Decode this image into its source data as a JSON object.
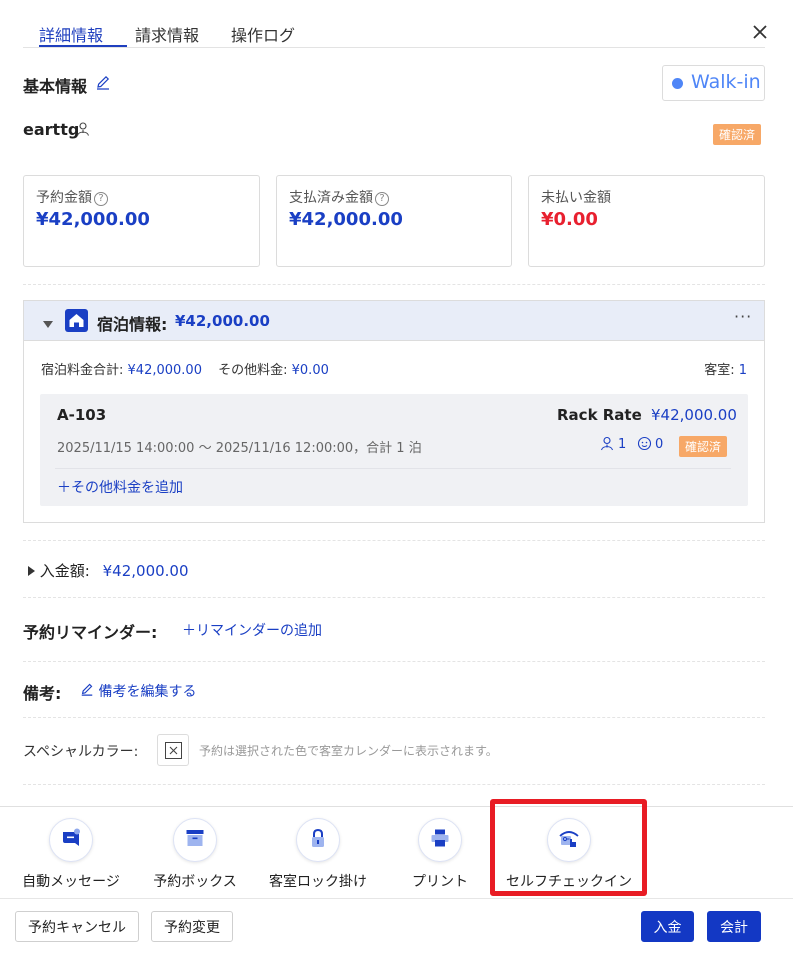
{
  "tabs": [
    "詳細情報",
    "請求情報",
    "操作ログ"
  ],
  "basic": {
    "title": "基本情報",
    "source": "Walk-in",
    "guest_name": "earttg",
    "status": "確認済"
  },
  "summary": [
    {
      "label": "予約金額",
      "value": "¥42,000.00",
      "color": "#1a3fc4"
    },
    {
      "label": "支払済み金額",
      "value": "¥42,000.00",
      "color": "#1a3fc4"
    },
    {
      "label": "未払い金額",
      "value": "¥0.00",
      "color": "#e8202f"
    }
  ],
  "stay": {
    "header_label": "宿泊情報:",
    "header_amount": "¥42,000.00",
    "room_total_label": "宿泊料金合計:",
    "room_total": "¥42,000.00",
    "other_label": "その他料金:",
    "other": "¥0.00",
    "rooms_label": "客室:",
    "rooms": "1",
    "room": {
      "name": "A-103",
      "rate_plan": "Rack Rate",
      "price": "¥42,000.00",
      "dates": "2025/11/15 14:00:00 ～ 2025/11/16 12:00:00，合計 1 泊",
      "adults": "1",
      "children": "0",
      "status": "確認済",
      "add_charge": "その他料金を追加"
    }
  },
  "deposit": {
    "label": "入金額:",
    "amount": "¥42,000.00"
  },
  "reminder": {
    "label": "予約リマインダー:",
    "add": "リマインダーの追加"
  },
  "notes": {
    "label": "備考:",
    "edit": "備考を編集する"
  },
  "special_color": {
    "label": "スペシャルカラー:",
    "hint": "予約は選択された色で客室カレンダーに表示されます。"
  },
  "actions": [
    "自動メッセージ",
    "予約ボックス",
    "客室ロック掛け",
    "プリント",
    "セルフチェックイン"
  ],
  "footer": {
    "cancel": "予約キャンセル",
    "modify": "予約変更",
    "payment": "入金",
    "checkout": "会計"
  },
  "colors": {
    "accent": "#1a3fc4",
    "primary_button": "#1338c4",
    "badge": "#f7a867",
    "highlight": "#e81c24"
  }
}
